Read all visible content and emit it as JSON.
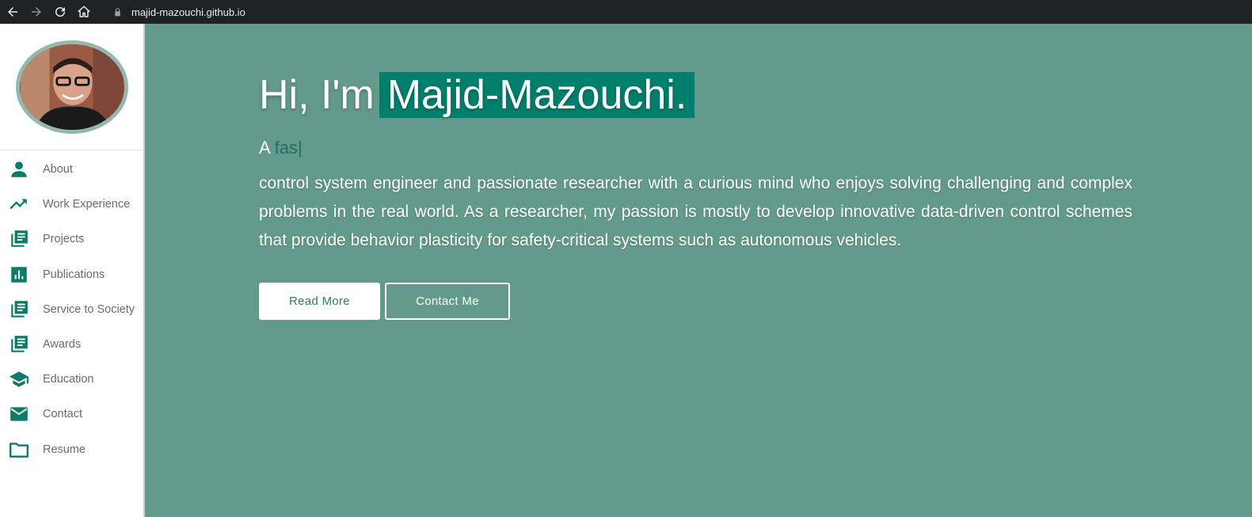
{
  "browser": {
    "url": "majid-mazouchi.github.io",
    "icons": [
      "back-arrow-icon",
      "forward-arrow-icon",
      "reload-icon",
      "home-icon",
      "lock-icon"
    ]
  },
  "sidebar": {
    "avatar": "profile-photo",
    "items": [
      {
        "label": "About",
        "icon": "person-icon"
      },
      {
        "label": "Work Experience",
        "icon": "trending-up-icon"
      },
      {
        "label": "Projects",
        "icon": "library-books-icon"
      },
      {
        "label": "Publications",
        "icon": "bar-chart-icon"
      },
      {
        "label": "Service to Society",
        "icon": "library-books-icon"
      },
      {
        "label": "Awards",
        "icon": "library-books-icon"
      },
      {
        "label": "Education",
        "icon": "graduation-cap-icon"
      },
      {
        "label": "Contact",
        "icon": "mail-icon"
      },
      {
        "label": "Resume",
        "icon": "folder-icon"
      }
    ]
  },
  "hero": {
    "greeting": "Hi, I'm",
    "name": "Majid-Mazouchi.",
    "typed_prefix": "A ",
    "typed_word": "fas",
    "cursor": "|",
    "description": "control system engineer and passionate researcher with a curious mind who enjoys solving challenging and complex problems in the real world. As a researcher, my passion is mostly to develop innovative data-driven control schemes that provide behavior plasticity for safety-critical systems such as autonomous vehicles.",
    "buttons": {
      "read_more": "Read More",
      "contact_me": "Contact Me"
    }
  },
  "colors": {
    "accent": "#007f6d",
    "hero_bg": "#639a8b",
    "icon": "#0e7a6b"
  }
}
